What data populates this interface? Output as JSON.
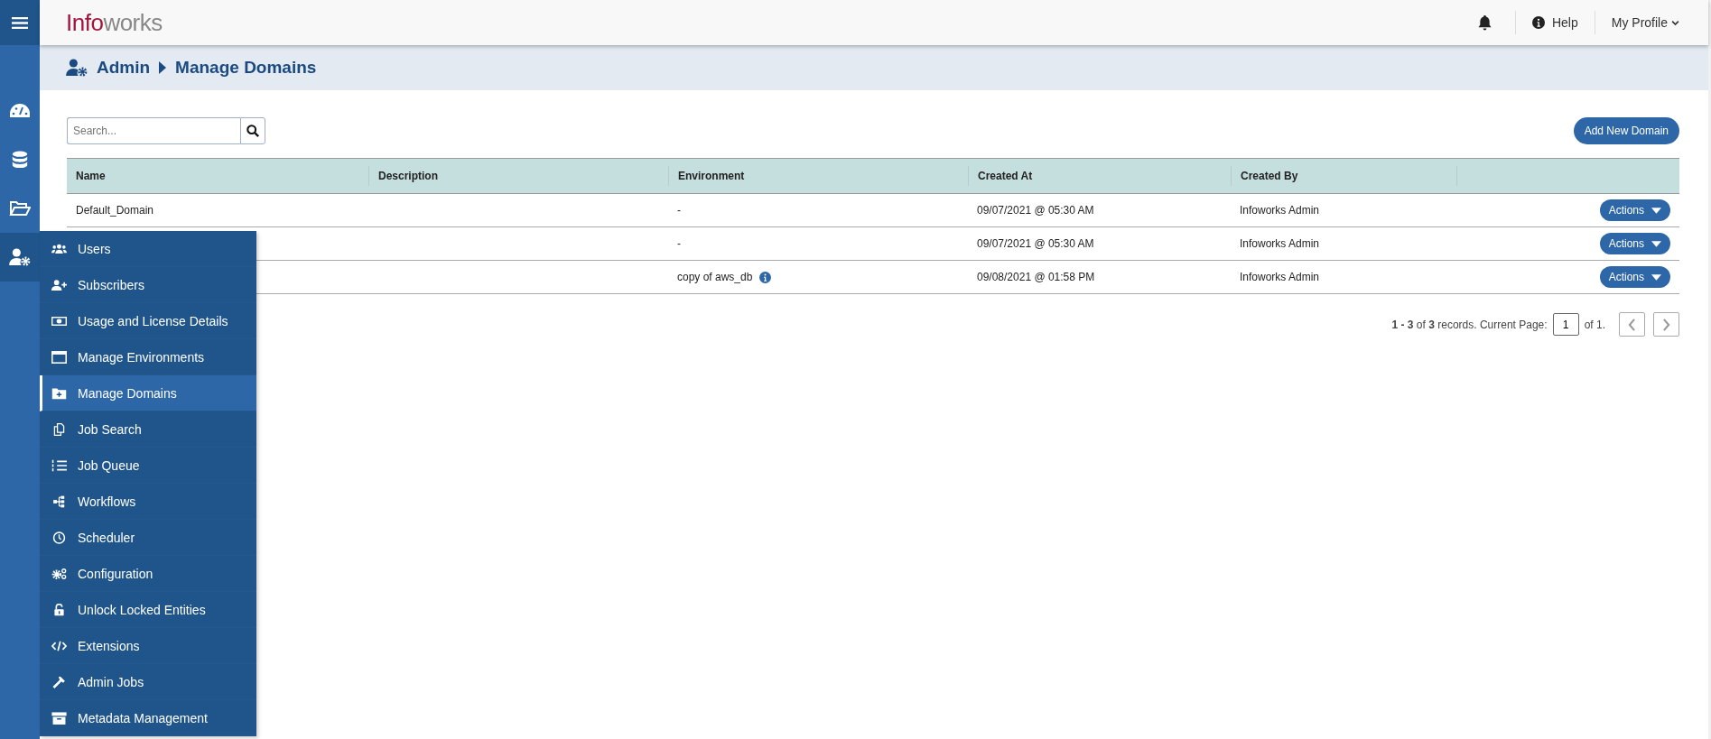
{
  "header": {
    "logo_accent": "Info",
    "logo_rest": "works",
    "help": "Help",
    "profile": "My Profile"
  },
  "rail": [
    {
      "kind": "dashboard",
      "selected": false
    },
    {
      "kind": "database",
      "selected": false
    },
    {
      "kind": "folder",
      "selected": false
    },
    {
      "kind": "admin",
      "selected": true
    }
  ],
  "breadcrumb": [
    "Admin",
    "Manage Domains"
  ],
  "search": {
    "placeholder": "Search..."
  },
  "add_button": "Add New Domain",
  "table": {
    "columns": [
      "Name",
      "Description",
      "Environment",
      "Created At",
      "Created By"
    ],
    "rows": [
      {
        "name": "Default_Domain",
        "environment": "-",
        "info": false,
        "created_at": "09/07/2021 @ 05:30 AM",
        "created_by": "Infoworks Admin",
        "action": "Actions"
      },
      {
        "environment": "-",
        "info": false,
        "created_at": "09/07/2021 @ 05:30 AM",
        "created_by": "Infoworks Admin",
        "action": "Actions"
      },
      {
        "environment": "copy of aws_db",
        "info": true,
        "created_at": "09/08/2021 @ 01:58 PM",
        "created_by": "Infoworks Admin",
        "action": "Actions"
      }
    ]
  },
  "pagination": {
    "summary": "**1 - 3** of **3** records. Current Page:",
    "page": "1",
    "of": "of 1."
  },
  "menu": {
    "items": [
      {
        "label": "Users",
        "kind": "users",
        "selected": false
      },
      {
        "label": "Subscribers",
        "kind": "user-plus",
        "selected": false
      },
      {
        "label": "Usage and License Details",
        "kind": "money",
        "selected": false
      },
      {
        "label": "Manage Environments",
        "kind": "window",
        "selected": false
      },
      {
        "label": "Manage Domains",
        "kind": "folder-plus",
        "selected": true
      },
      {
        "label": "Job Search",
        "kind": "copy",
        "selected": false
      },
      {
        "label": "Job Queue",
        "kind": "list",
        "selected": false
      },
      {
        "label": "Workflows",
        "kind": "tree",
        "selected": false
      },
      {
        "label": "Scheduler",
        "kind": "clock",
        "selected": false
      },
      {
        "label": "Configuration",
        "kind": "gears",
        "selected": false
      },
      {
        "label": "Unlock Locked Entities",
        "kind": "unlock",
        "selected": false
      },
      {
        "label": "Extensions",
        "kind": "code",
        "selected": false
      },
      {
        "label": "Admin Jobs",
        "kind": "hammer",
        "selected": false
      },
      {
        "label": "Metadata Management",
        "kind": "archive",
        "selected": false
      }
    ]
  }
}
